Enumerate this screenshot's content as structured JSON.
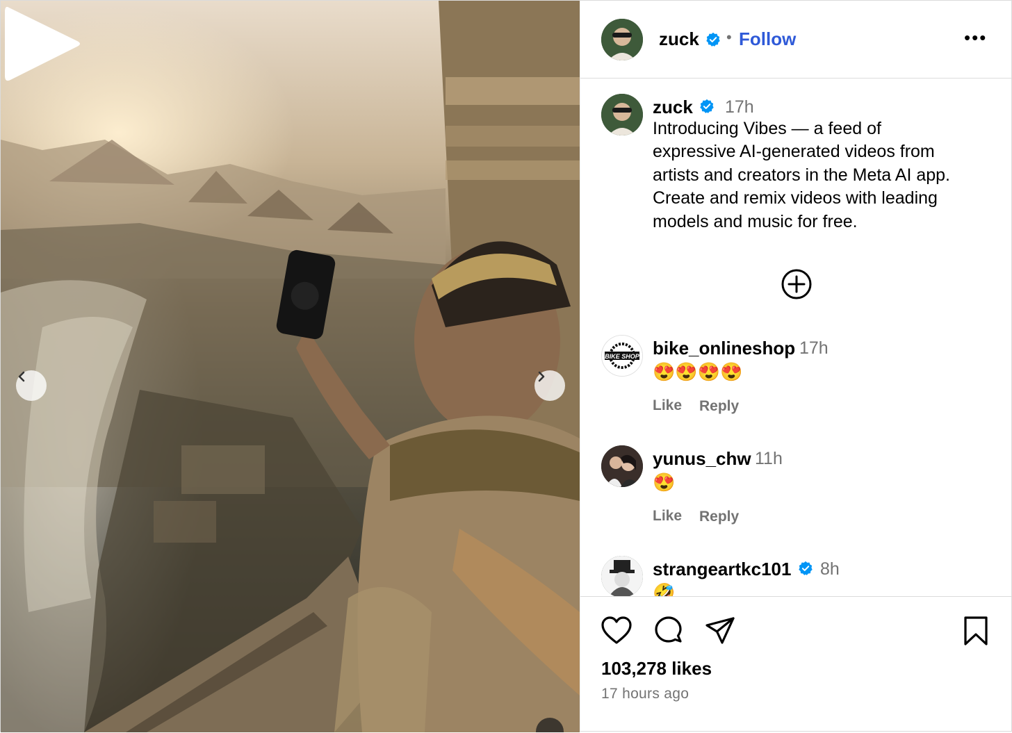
{
  "post": {
    "author": "zuck",
    "follow_label": "Follow",
    "dot": "•",
    "more_label": "•••"
  },
  "caption": {
    "author": "zuck",
    "time": "17h",
    "lines": [
      "Introducing Vibes — a feed of",
      "expressive AI-generated videos from",
      "artists and creators in the Meta AI app.",
      "Create and remix videos with leading",
      "models and music for free."
    ]
  },
  "comments": [
    {
      "user": "bike_onlineshop",
      "time": "17h",
      "text": "😍😍😍😍",
      "like": "Like",
      "reply": "Reply",
      "avatar_label": "BIKE SHOP"
    },
    {
      "user": "yunus_chw",
      "time": "11h",
      "text": "😍",
      "like": "Like",
      "reply": "Reply"
    },
    {
      "user": "strangeartkc101",
      "time": "8h",
      "text": "🤣",
      "verified": true
    }
  ],
  "footer": {
    "likes": "103,278 likes",
    "ago": "17 hours ago"
  },
  "icons": [
    "heart-icon",
    "comment-icon",
    "share-icon",
    "bookmark-icon",
    "plus-circle-icon",
    "play-icon",
    "chevron-left-icon",
    "chevron-right-icon",
    "verified-icon",
    "mute-icon"
  ],
  "colors": {
    "follow": "#2f5ad8",
    "verified": "#0095f6",
    "muted_text": "#737373"
  }
}
